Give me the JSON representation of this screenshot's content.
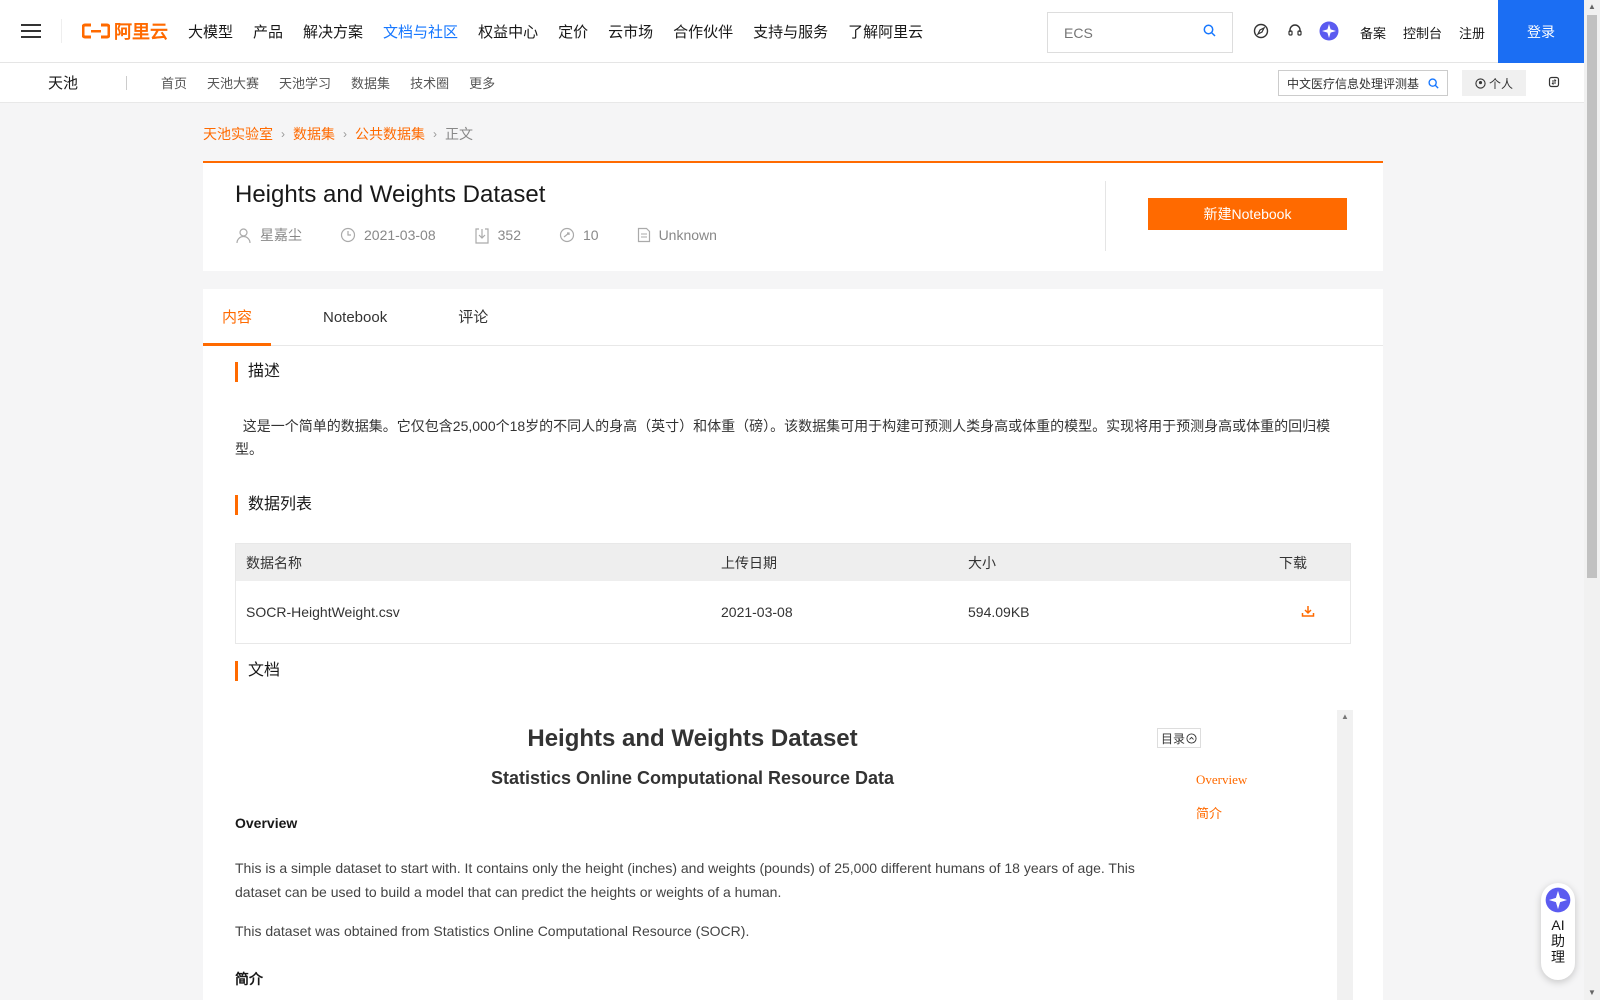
{
  "nav": {
    "logo_text": "阿里云",
    "items": [
      "大模型",
      "产品",
      "解决方案",
      "文档与社区",
      "权益中心",
      "定价",
      "云市场",
      "合作伙伴",
      "支持与服务",
      "了解阿里云"
    ],
    "active_index": 3,
    "search_placeholder": "ECS",
    "links": [
      "备案",
      "控制台",
      "注册"
    ],
    "login": "登录"
  },
  "subnav": {
    "brand": "天池",
    "items": [
      "首页",
      "天池大赛",
      "天池学习",
      "数据集",
      "技术圈",
      "更多"
    ],
    "search_text": "中文医疗信息处理评测基",
    "personal": "个人"
  },
  "breadcrumb": [
    "天池实验室",
    "数据集",
    "公共数据集",
    "正文"
  ],
  "dataset": {
    "title": "Heights and Weights Dataset",
    "author": "星嘉尘",
    "date": "2021-03-08",
    "downloads": "352",
    "shares": "10",
    "license": "Unknown",
    "new_notebook": "新建Notebook"
  },
  "tabs": [
    "内容",
    "Notebook",
    "评论"
  ],
  "sections": {
    "description_title": "描述",
    "description_text": "这是一个简单的数据集。它仅包含25,000个18岁的不同人的身高（英寸）和体重（磅）。该数据集可用于构建可预测人类身高或体重的模型。实现将用于预测身高或体重的回归模型。",
    "datalist_title": "数据列表",
    "doc_title": "文档"
  },
  "table": {
    "headers": [
      "数据名称",
      "上传日期",
      "大小",
      "下载"
    ],
    "rows": [
      {
        "name": "SOCR-HeightWeight.csv",
        "date": "2021-03-08",
        "size": "594.09KB"
      }
    ]
  },
  "doc": {
    "h1": "Heights and Weights Dataset",
    "h2": "Statistics Online Computational Resource Data",
    "overview_title": "Overview",
    "p1": "This is a simple dataset to start with. It contains only the height (inches) and weights (pounds) of 25,000 different humans of 18 years of age. This dataset can be used to build a model that can predict the heights or weights of a human.",
    "p2": "This dataset was obtained from Statistics Online Computational Resource (SOCR).",
    "intro_title": "简介",
    "toc_label": "目录",
    "toc_items": [
      "Overview",
      "简介"
    ]
  },
  "ai": {
    "label": "AI助理"
  },
  "colors": {
    "accent": "#ff6a00",
    "nav_active": "#1677ff",
    "login_bg": "#1b6ef3"
  }
}
